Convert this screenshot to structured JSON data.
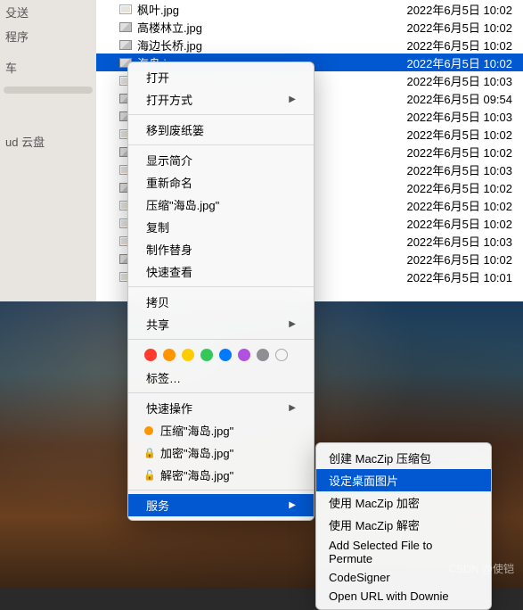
{
  "sidebar": {
    "items": [
      {
        "label": "殳送"
      },
      {
        "label": "程序"
      },
      {
        "label": ""
      },
      {
        "label": "车"
      },
      {
        "label": ""
      },
      {
        "label": ""
      },
      {
        "label": "ud 云盘"
      }
    ],
    "selected_index": 5
  },
  "files": [
    {
      "name": "枫叶.jpg",
      "date": "2022年6月5日 10:02",
      "icon": "jpg"
    },
    {
      "name": "高楼林立.jpg",
      "date": "2022年6月5日 10:02",
      "icon": "img"
    },
    {
      "name": "海边长桥.jpg",
      "date": "2022年6月5日 10:02",
      "icon": "img"
    },
    {
      "name": "海岛.j",
      "date": "2022年6月5日 10:02",
      "icon": "img",
      "selected": true
    },
    {
      "name": "",
      "date": "2022年6月5日 10:03",
      "icon": "jpg"
    },
    {
      "name": "",
      "date": "2022年6月5日 09:54",
      "icon": "img"
    },
    {
      "name": "",
      "date": "2022年6月5日 10:03",
      "icon": "img"
    },
    {
      "name": "",
      "date": "2022年6月5日 10:02",
      "icon": "jpg"
    },
    {
      "name": "",
      "date": "2022年6月5日 10:02",
      "icon": "img"
    },
    {
      "name": "",
      "date": "2022年6月5日 10:03",
      "icon": "jpg"
    },
    {
      "name": "",
      "date": "2022年6月5日 10:02",
      "icon": "img"
    },
    {
      "name": "",
      "date": "2022年6月5日 10:02",
      "icon": "jpg"
    },
    {
      "name": "",
      "date": "2022年6月5日 10:02",
      "icon": "jpg"
    },
    {
      "name": "",
      "date": "2022年6月5日 10:03",
      "icon": "jpg"
    },
    {
      "name": "",
      "date": "2022年6月5日 10:02",
      "icon": "img"
    },
    {
      "name": "",
      "date": "2022年6月5日 10:01",
      "icon": "jpg"
    }
  ],
  "context_menu": {
    "open": "打开",
    "open_with": "打开方式",
    "trash": "移到废纸篓",
    "get_info": "显示简介",
    "rename": "重新命名",
    "compress": "压缩\"海岛.jpg\"",
    "duplicate": "复制",
    "make_alias": "制作替身",
    "quick_look": "快速查看",
    "copy": "拷贝",
    "share": "共享",
    "tags_label": "标签…",
    "quick_actions": "快速操作",
    "qa_compress": "压缩\"海岛.jpg\"",
    "qa_encrypt": "加密\"海岛.jpg\"",
    "qa_decrypt": "解密\"海岛.jpg\"",
    "services": "服务",
    "tag_colors": [
      "#ff3b30",
      "#ff9500",
      "#ffcc00",
      "#34c759",
      "#007aff",
      "#af52de",
      "#8e8e93"
    ]
  },
  "submenu": {
    "items": [
      "创建 MacZip 压缩包",
      "设定桌面图片",
      "使用 MacZip 加密",
      "使用 MacZip 解密",
      "Add Selected File to Permute",
      "CodeSigner",
      "Open URL with Downie"
    ],
    "highlighted_index": 1
  },
  "watermark": "CSDN @使铠"
}
